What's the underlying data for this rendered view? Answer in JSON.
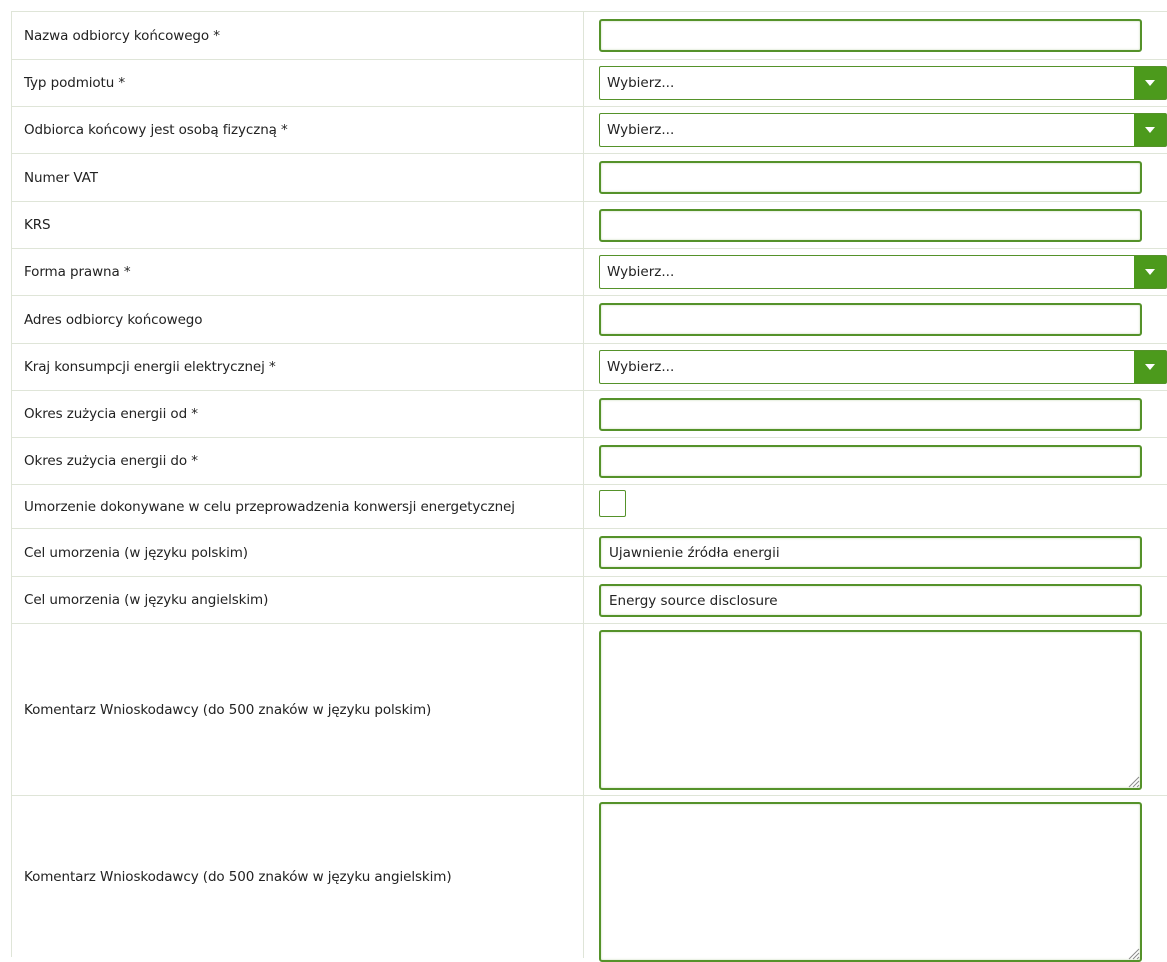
{
  "form": {
    "rows": [
      {
        "label": "Nazwa odbiorcy końcowego *",
        "type": "text",
        "value": ""
      },
      {
        "label": "Typ podmiotu *",
        "type": "select",
        "value": "Wybierz..."
      },
      {
        "label": "Odbiorca końcowy jest osobą fizyczną *",
        "type": "select",
        "value": "Wybierz..."
      },
      {
        "label": "Numer VAT",
        "type": "text",
        "value": ""
      },
      {
        "label": "KRS",
        "type": "text",
        "value": ""
      },
      {
        "label": "Forma prawna *",
        "type": "select",
        "value": "Wybierz..."
      },
      {
        "label": "Adres odbiorcy końcowego",
        "type": "text",
        "value": ""
      },
      {
        "label": "Kraj konsumpcji energii elektrycznej *",
        "type": "select",
        "value": "Wybierz..."
      },
      {
        "label": "Okres zużycia energii od *",
        "type": "text",
        "value": ""
      },
      {
        "label": "Okres zużycia energii do *",
        "type": "text",
        "value": ""
      },
      {
        "label": "Umorzenie dokonywane w celu przeprowadzenia konwersji energetycznej",
        "type": "checkbox",
        "checked": false
      },
      {
        "label": "Cel umorzenia (w języku polskim)",
        "type": "text",
        "value": "Ujawnienie źródła energii"
      },
      {
        "label": "Cel umorzenia (w języku angielskim)",
        "type": "text",
        "value": "Energy source disclosure"
      },
      {
        "label": "Komentarz Wnioskodawcy (do 500 znaków w języku polskim)",
        "type": "textarea",
        "value": ""
      },
      {
        "label": "Komentarz Wnioskodawcy (do 500 znaków w języku angielskim)",
        "type": "textarea",
        "value": ""
      }
    ]
  },
  "colors": {
    "accent": "#55922a",
    "select_button": "#4c9a1c",
    "row_divider": "#dfe5d8"
  },
  "icons": {
    "select_arrow": "chevron-down-icon",
    "textarea_grip": "resize-grip-icon"
  }
}
